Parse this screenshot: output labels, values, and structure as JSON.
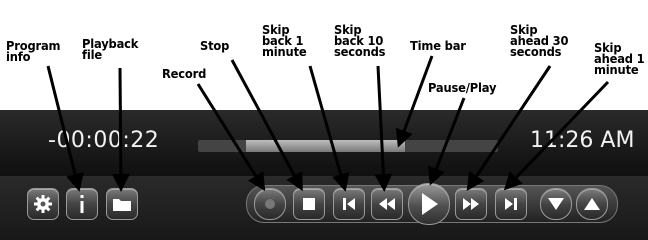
{
  "annotations": {
    "program_info": "Program\ninfo",
    "playback_file": "Playback\nfile",
    "stop": "Stop",
    "skip_back_1": "Skip\nback 1\nminute",
    "skip_back_10": "Skip\nback 10\nseconds",
    "time_bar": "Time bar",
    "skip_ahead_30": "Skip\nahead 30\nseconds",
    "skip_ahead_1": "Skip\nahead 1\nminute",
    "record": "Record",
    "pause_play": "Pause/Play"
  },
  "player": {
    "elapsed": "-00:00:22",
    "clock": "11:26 AM",
    "progress_fraction": 0.69,
    "accent": "#f2f2f2"
  },
  "icons": {
    "settings": "gear-icon",
    "info": "info-icon",
    "playback": "folder-icon",
    "record": "record-icon",
    "stop": "stop-icon",
    "skip_back_1": "skip-back-icon",
    "skip_back_10": "rewind-icon",
    "play": "play-icon",
    "skip_ahead_30": "fast-forward-icon",
    "skip_ahead_1": "skip-forward-icon",
    "down": "triangle-down-icon",
    "up": "triangle-up-icon"
  }
}
